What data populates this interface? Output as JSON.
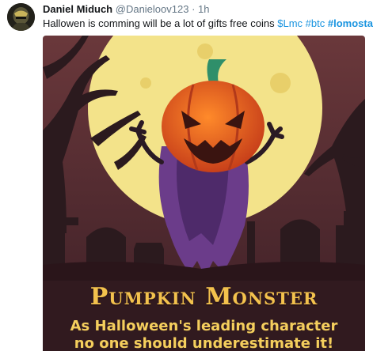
{
  "tweet": {
    "author_name": "Daniel Miduch",
    "handle": "@Danieloov123",
    "separator": "·",
    "time": "1h",
    "text_plain": "Hallowen is comming  will be a lot of gifts free coins ",
    "hashtags": [
      "$Lmc",
      "#btc",
      "#lomostar"
    ]
  },
  "poster": {
    "title": "Pumpkin Monster",
    "subtitle_line1": "As Halloween's leading character",
    "subtitle_line2": "no one should underestimate it!"
  },
  "colors": {
    "link": "#1b95e0",
    "poster_bg": "#5a2f33",
    "moon": "#f3e38a",
    "title_gold": "#f3c24d"
  },
  "icons": {
    "avatar": "masked-figure-avatar"
  }
}
